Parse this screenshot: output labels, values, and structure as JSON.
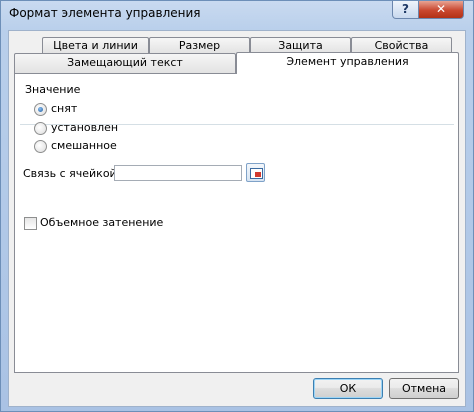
{
  "window": {
    "title": "Формат элемента управления",
    "help_glyph": "?",
    "close_glyph": "✕"
  },
  "tabs": {
    "row1": [
      "Цвета и линии",
      "Размер",
      "Защита",
      "Свойства"
    ],
    "row2": [
      "Замещающий текст",
      "Элемент управления"
    ],
    "active": "Элемент управления"
  },
  "value_group": {
    "label": "Значение",
    "options": [
      {
        "label": "снят",
        "checked": true
      },
      {
        "label": "установлен",
        "checked": false
      },
      {
        "label": "смешанное",
        "checked": false
      }
    ]
  },
  "cell_link": {
    "label": "Связь с ячейкой:",
    "value": ""
  },
  "shading": {
    "label": "Объемное затенение",
    "checked": false
  },
  "buttons": {
    "ok": "ОК",
    "cancel": "Отмена"
  }
}
